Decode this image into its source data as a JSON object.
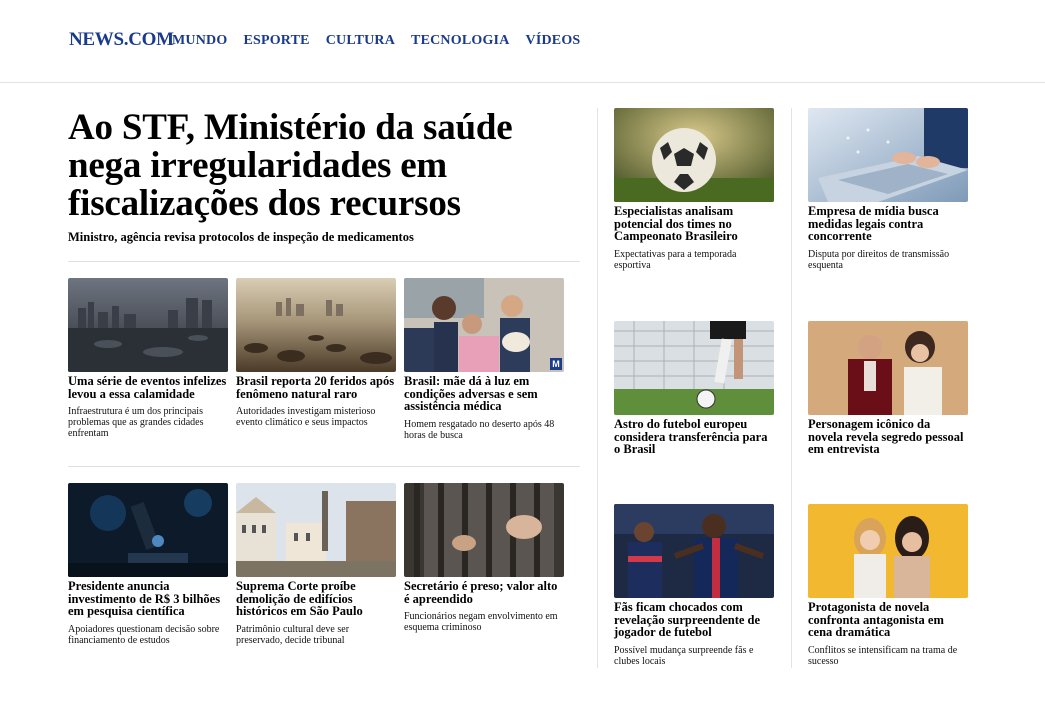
{
  "header": {
    "logo": "NEWS.COM",
    "nav": [
      "MUNDO",
      "ESPORTE",
      "CULTURA",
      "TECNOLOGIA",
      "VÍDEOS"
    ]
  },
  "main": {
    "headline": "Ao STF, Ministério da saúde nega irregularidades em fiscalizações dos recursos",
    "subhead": "Ministro, agência revisa protocolos de inspeção de medicamentos"
  },
  "grid_row1": [
    {
      "title": "Uma série de eventos infelizes levou a essa calamidade",
      "desc": "Infraestrutura é um dos principais problemas que as grandes cidades enfrentam"
    },
    {
      "title": "Brasil reporta 20 feridos após fenômeno natural raro",
      "desc": "Autoridades investigam misterioso evento climático e seus impactos"
    },
    {
      "title": "Brasil: mãe dá à luz em condições adversas e sem assistência médica",
      "desc": "Homem resgatado no deserto após 48 horas de busca",
      "badge": "M"
    }
  ],
  "grid_row2": [
    {
      "title": "Presidente anuncia investimento de R$ 3 bilhões em pesquisa científica",
      "desc": "Apoiadores questionam decisão sobre financiamento de estudos"
    },
    {
      "title": "Suprema Corte proíbe demolição de edifícios históricos em São Paulo",
      "desc": "Patrimônio cultural deve ser preservado, decide tribunal"
    },
    {
      "title": "Secretário é preso; valor alto é apreendido",
      "desc": "Funcionários negam envolvimento em esquema criminoso"
    }
  ],
  "sidebar_col1": [
    {
      "title": "Especialistas analisam potencial dos times no Campeonato Brasileiro",
      "desc": "Expectativas para a temporada esportiva"
    },
    {
      "title": "Astro do futebol europeu considera transferência para o Brasil",
      "desc": ""
    },
    {
      "title": "Fãs ficam chocados com revelação surpreendente de jogador de futebol",
      "desc": "Possível mudança surpreende fãs e clubes locais"
    }
  ],
  "sidebar_col2": [
    {
      "title": "Empresa de mídia busca medidas legais contra concorrente",
      "desc": "Disputa por direitos de transmissão esquenta"
    },
    {
      "title": "Personagem icônico da novela revela segredo pessoal em entrevista",
      "desc": ""
    },
    {
      "title": "Protagonista de novela confronta antagonista em cena dramática",
      "desc": "Conflitos se intensificam na trama de sucesso"
    }
  ],
  "colors": {
    "brand": "#1a3a8c",
    "divider": "#e3e3e3"
  },
  "image_icons": [
    "city-flood-photo",
    "dry-riverbed-photo",
    "family-rescue-photo",
    "microscope-photo",
    "historic-buildings-photo",
    "prison-bars-photo",
    "soccer-ball-photo",
    "laptop-photo",
    "football-kick-photo",
    "couple-portrait-photo",
    "soccer-players-photo",
    "actresses-portrait-photo"
  ]
}
